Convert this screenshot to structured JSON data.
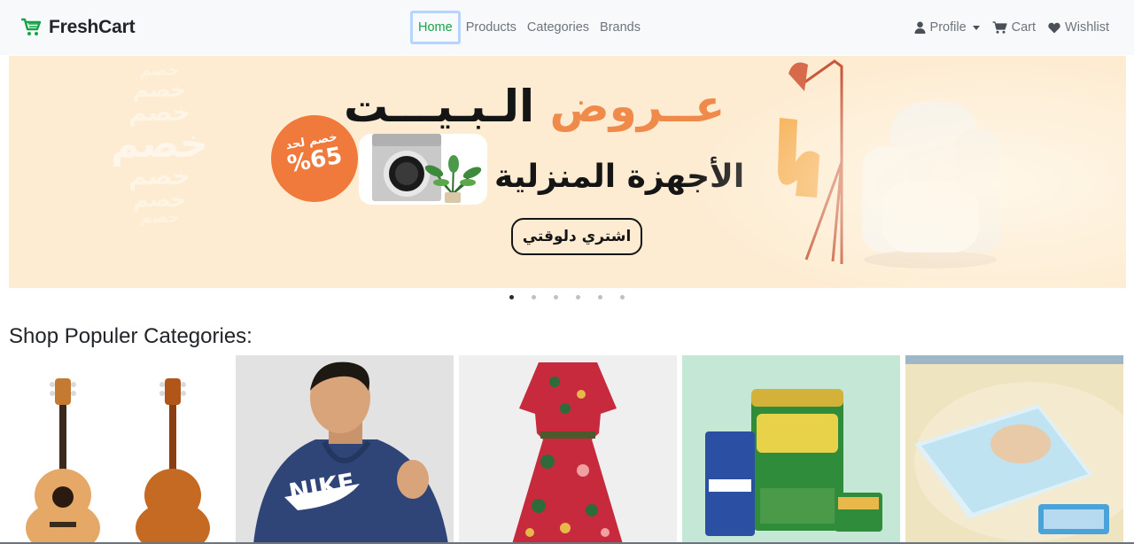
{
  "brand": {
    "name": "FreshCart",
    "icon": "cart-icon",
    "accent": "#16a34a"
  },
  "nav": {
    "links": [
      {
        "label": "Home",
        "active": true
      },
      {
        "label": "Products",
        "active": false
      },
      {
        "label": "Categories",
        "active": false
      },
      {
        "label": "Brands",
        "active": false
      }
    ],
    "right": {
      "profile": {
        "label": "Profile",
        "icon": "user-icon"
      },
      "cart": {
        "label": "Cart",
        "icon": "shopping-cart-icon"
      },
      "wishlist": {
        "label": "Wishlist",
        "icon": "heart-icon"
      }
    }
  },
  "slider": {
    "title_orange": "عــروض",
    "title_dark": "الـبـيـــت",
    "subtitle": "الأجهزة المنزلية",
    "badge_top": "خصم لحد",
    "badge_value": "%65",
    "cta": "اشتري دلوقتي",
    "watermark": [
      "خصم",
      "خصم",
      "خصم",
      "خصم",
      "خصم",
      "خصم",
      "خصم"
    ],
    "slide_count": 6,
    "active_slide": 1
  },
  "categories": {
    "title": "Shop Populer Categories:",
    "items": [
      {
        "name": "music-category-image"
      },
      {
        "name": "mens-fashion-category-image"
      },
      {
        "name": "womens-fashion-category-image"
      },
      {
        "name": "supermarket-category-image"
      },
      {
        "name": "baby-toys-category-image"
      }
    ]
  }
}
